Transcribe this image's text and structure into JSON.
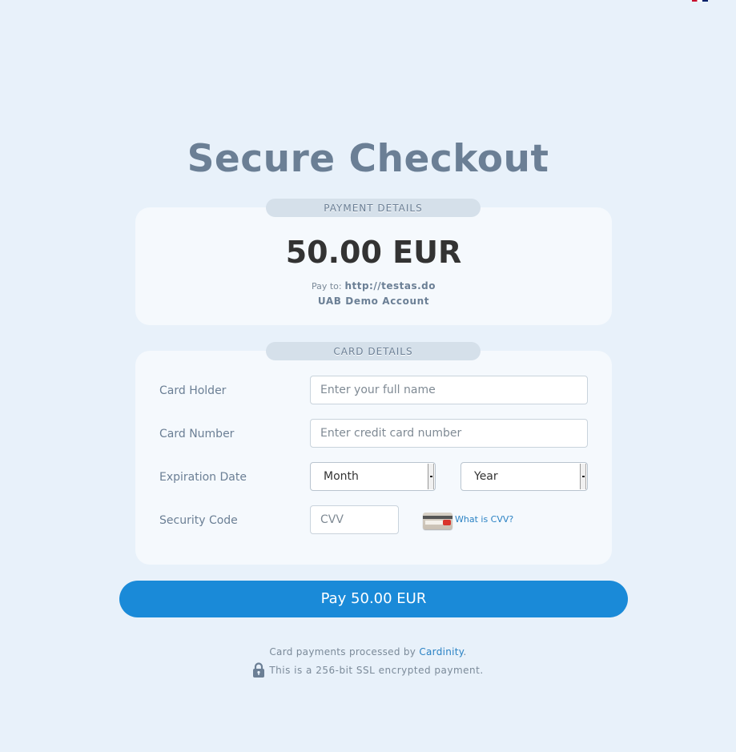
{
  "header": {
    "title": "Secure Checkout",
    "language_flag_icon": "uk-flag-icon"
  },
  "payment_details": {
    "section_label": "PAYMENT DETAILS",
    "amount": "50.00 EUR",
    "pay_to_label": "Pay to:",
    "pay_to_value": "http://testas.do",
    "merchant_name": "UAB Demo Account"
  },
  "card_details": {
    "section_label": "CARD DETAILS",
    "card_holder": {
      "label": "Card Holder",
      "placeholder": "Enter your full name",
      "value": ""
    },
    "card_number": {
      "label": "Card Number",
      "placeholder": "Enter credit card number",
      "value": ""
    },
    "expiration": {
      "label": "Expiration Date",
      "month_selected": "Month",
      "year_selected": "Year"
    },
    "security_code": {
      "label": "Security Code",
      "placeholder": "CVV",
      "value": "",
      "help_link": "What is CVV?",
      "help_icon": "credit-card-back-icon"
    }
  },
  "pay_button": {
    "label": "Pay 50.00 EUR"
  },
  "footer": {
    "processed_by_prefix": "Card payments processed by ",
    "processor_name": "Cardinity",
    "processed_by_suffix": ".",
    "ssl_text": "This is a 256-bit SSL encrypted payment.",
    "lock_icon": "lock-icon"
  },
  "colors": {
    "background": "#e8f1fa",
    "panel": "#f5f9fd",
    "accent": "#1a8ad8",
    "title": "#6b7f95",
    "link": "#2a82c4"
  }
}
